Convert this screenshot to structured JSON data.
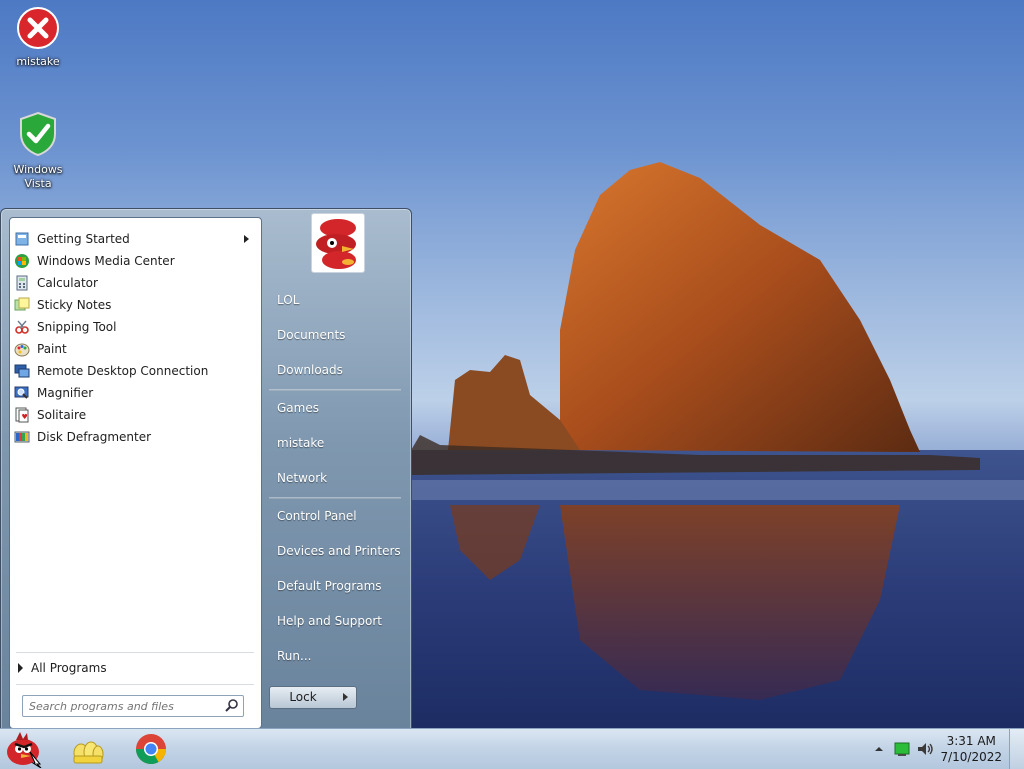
{
  "desktop": {
    "icons": [
      {
        "label": "mistake",
        "icon": "red-x-error-icon"
      },
      {
        "label": "Windows Vista",
        "icon": "green-shield-check-icon"
      }
    ]
  },
  "start_menu": {
    "programs": [
      {
        "label": "Getting Started",
        "icon": "getting-started-icon",
        "has_submenu": true
      },
      {
        "label": "Windows Media Center",
        "icon": "media-center-icon"
      },
      {
        "label": "Calculator",
        "icon": "calculator-icon"
      },
      {
        "label": "Sticky Notes",
        "icon": "sticky-notes-icon"
      },
      {
        "label": "Snipping Tool",
        "icon": "snipping-tool-icon"
      },
      {
        "label": "Paint",
        "icon": "paint-icon"
      },
      {
        "label": "Remote Desktop Connection",
        "icon": "remote-desktop-icon"
      },
      {
        "label": "Magnifier",
        "icon": "magnifier-icon"
      },
      {
        "label": "Solitaire",
        "icon": "solitaire-icon"
      },
      {
        "label": "Disk Defragmenter",
        "icon": "disk-defragmenter-icon"
      }
    ],
    "all_programs_label": "All Programs",
    "search_placeholder": "Search programs and files",
    "right_items": {
      "group1": [
        "LOL",
        "Documents",
        "Downloads"
      ],
      "group2": [
        "Games",
        "mistake",
        "Network"
      ],
      "group3": [
        "Control Panel",
        "Devices and Printers",
        "Default Programs",
        "Help and Support",
        "Run..."
      ]
    },
    "lock_label": "Lock"
  },
  "taskbar": {
    "pinned": [
      {
        "name": "angry-bird-start-orb-icon"
      },
      {
        "name": "file-explorer-folder-icon"
      },
      {
        "name": "chrome-icon"
      }
    ],
    "clock_time": "3:31 AM",
    "clock_date": "7/10/2022"
  },
  "colors": {
    "accent": "#6a839c",
    "taskbar": "#c2d3e6"
  }
}
